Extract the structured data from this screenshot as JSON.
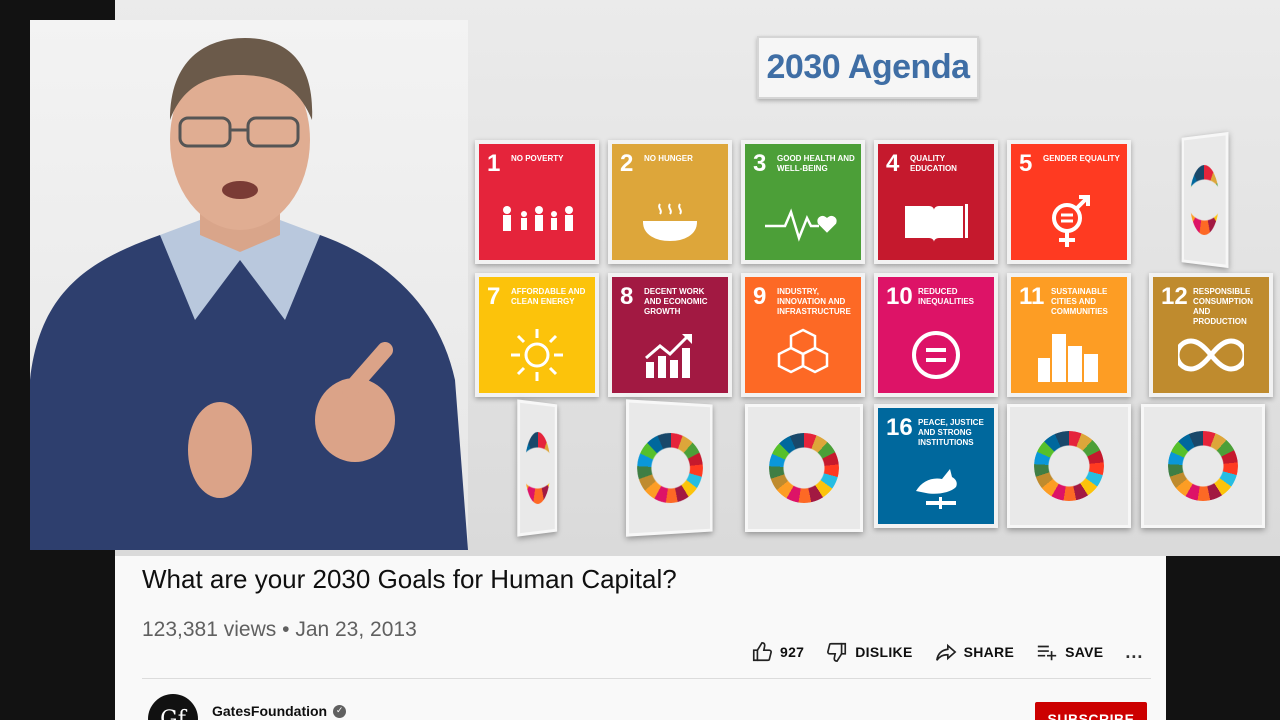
{
  "player": {
    "agenda_title": "2030 Agenda",
    "goals": [
      {
        "num": "1",
        "label": "No Poverty",
        "color": "#e5243b",
        "icon": "people-icon"
      },
      {
        "num": "2",
        "label": "No Hunger",
        "color": "#dda63a",
        "icon": "bowl-icon"
      },
      {
        "num": "3",
        "label": "Good Health and Well-Being",
        "color": "#4c9f38",
        "icon": "heartbeat-icon"
      },
      {
        "num": "4",
        "label": "Quality Education",
        "color": "#c5192d",
        "icon": "book-icon"
      },
      {
        "num": "5",
        "label": "Gender Equality",
        "color": "#ff3a21",
        "icon": "gender-icon"
      },
      {
        "num": "7",
        "label": "Affordable and Clean Energy",
        "color": "#fcc30b",
        "icon": "sun-icon"
      },
      {
        "num": "8",
        "label": "Decent Work and Economic Growth",
        "color": "#a21942",
        "icon": "growth-chart-icon"
      },
      {
        "num": "9",
        "label": "Industry, Innovation and Infrastructure",
        "color": "#fd6925",
        "icon": "cubes-icon"
      },
      {
        "num": "10",
        "label": "Reduced Inequalities",
        "color": "#dd1367",
        "icon": "equals-icon"
      },
      {
        "num": "11",
        "label": "Sustainable Cities and Communities",
        "color": "#fd9d24",
        "icon": "buildings-icon"
      },
      {
        "num": "12",
        "label": "Responsible Consumption and Production",
        "color": "#bf8b2e",
        "icon": "infinity-icon"
      },
      {
        "num": "16",
        "label": "Peace, Justice and Strong Institutions",
        "color": "#00689d",
        "icon": "dove-icon"
      }
    ]
  },
  "video": {
    "title": "What are your 2030 Goals for Human Capital?",
    "views": "123,381 views",
    "separator": "•",
    "date": "Jan 23, 2013"
  },
  "actions": {
    "like_count": "927",
    "dislike_label": "DISLIKE",
    "share_label": "SHARE",
    "save_label": "SAVE",
    "more_label": "..."
  },
  "channel": {
    "avatar_text": "Gf",
    "name": "GatesFoundation",
    "verified_mark": "✓",
    "subscribe_label": "SUBSCRIBE"
  }
}
